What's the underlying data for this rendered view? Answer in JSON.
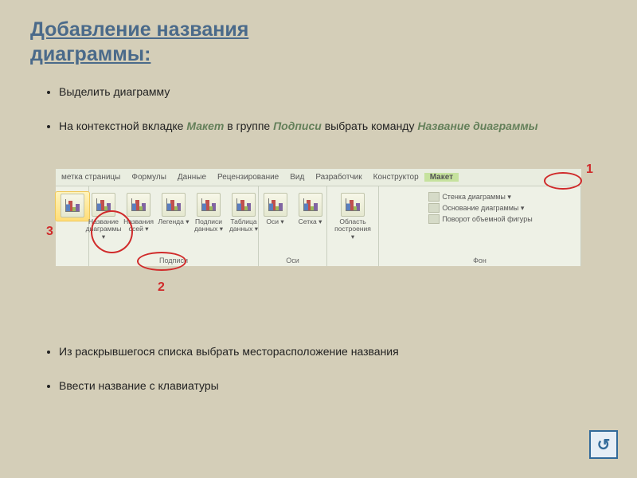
{
  "title_line1": "Добавление названия",
  "title_line2": "диаграммы:",
  "bullets_top": {
    "b1": "Выделить диаграмму",
    "b2_a": "На контекстной вкладке ",
    "b2_it1": "Макет",
    "b2_b": " в группе ",
    "b2_it2": "Подписи",
    "b2_c": " выбрать команду ",
    "b2_it3": "Название диаграммы"
  },
  "bullets_bottom": {
    "b3": "Из раскрывшегося списка выбрать месторасположение названия",
    "b4": "Ввести название с клавиатуры"
  },
  "ribbon": {
    "tabs": {
      "t1": "метка страницы",
      "t2": "Формулы",
      "t3": "Данные",
      "t4": "Рецензирование",
      "t5": "Вид",
      "t6": "Разработчик",
      "t7": "Конструктор",
      "t8": "Макет"
    },
    "g2_label": "Подписи",
    "g3_label": "Оси",
    "g5_label": "Фон",
    "btns": {
      "nazv": "Название диаграммы ▾",
      "nazv_osei": "Названия осей ▾",
      "legend": "Легенда ▾",
      "podpisi": "Подписи данных ▾",
      "tabl": "Таблица данных ▾",
      "osi": "Оси ▾",
      "setka": "Сетка ▾",
      "oblast": "Область построения ▾",
      "stenka": "Стенка диаграммы ▾",
      "osnov": "Основание диаграммы ▾",
      "povorot": "Поворот объемной фигуры"
    }
  },
  "annotations": {
    "n1": "1",
    "n2": "2",
    "n3": "3"
  },
  "return_glyph": "↺"
}
